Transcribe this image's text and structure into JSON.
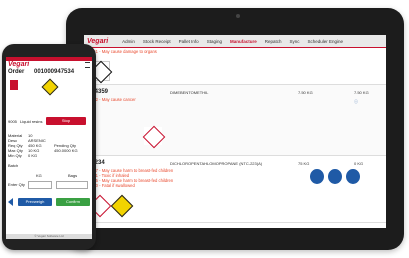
{
  "tablet": {
    "logo": "Vegari",
    "nav": [
      "Admin",
      "Stock Receipt",
      "Pallet Info",
      "Staging",
      "Manufacture",
      "Repatch",
      "Sync",
      "Scheduler Engine"
    ],
    "top_warning": "H361 - May cause damage to organs",
    "rows": [
      {
        "code": "614359",
        "name": "DIMEBENTOMETHIL",
        "qty": "7.50 KG",
        "qty2": "7.50 KG",
        "warnings": [
          "H302 - May cause cancer"
        ]
      },
      {
        "code": "47234",
        "name": "DICHLOROPENTAHLOMOPROPANE (NTC-223(A)",
        "qty": "75 KG",
        "qty2": "0 KG",
        "warnings": [
          "H327 - May cause harm to breast-fed children",
          "H301 - Toxic if inhaled",
          "H315 - May cause harm to breast-fed children",
          "H330 - Fatal if swallowed"
        ]
      }
    ]
  },
  "phone": {
    "logo": "Vegari",
    "order_label": "Order",
    "order_number": "001000947534",
    "item_code": "9005",
    "item_name": "Liquid resins",
    "stop_label": "Stop",
    "details": [
      {
        "label": "Material",
        "value": "10"
      },
      {
        "label": "Desc",
        "value": "ARSENIC"
      },
      {
        "label": "Req Qty",
        "value": "450 KG"
      },
      {
        "label": "Max Qty",
        "value": "10 KG"
      },
      {
        "label": "Min Qty",
        "value": "0 KG"
      }
    ],
    "pending_label": "Pending Qty",
    "pending_value": "450.0000 KG",
    "batch_label": "Batch",
    "kg_label": "KG",
    "bags_label": "Bags",
    "enter_qty_label": "Enter Qty",
    "prev_label": "Prevweigh",
    "confirm_label": "Confirm",
    "footer": "© Vegari Software Ltd"
  }
}
